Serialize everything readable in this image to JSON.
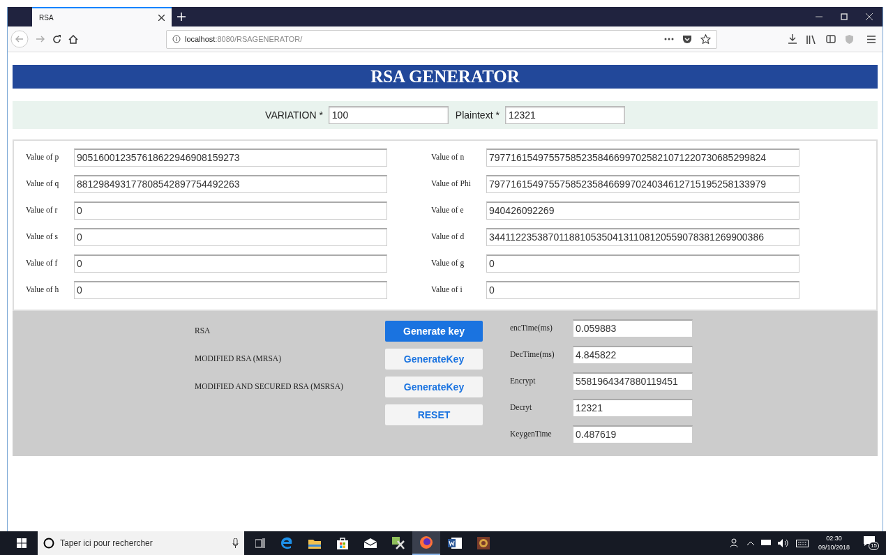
{
  "browser": {
    "tabs": [
      {
        "title": "RSA",
        "selected": true
      }
    ],
    "url_host": "localhost",
    "url_path": ":8080/RSAGENERATOR/"
  },
  "page": {
    "title": "RSA GENERATOR",
    "inputs": [
      {
        "label": "VARIATION *",
        "value": "100"
      },
      {
        "label": "Plaintext *",
        "value": "12321"
      }
    ],
    "fields_left": [
      {
        "label": "Value of p",
        "value": "905160012357618622946908159273"
      },
      {
        "label": "Value of q",
        "value": "881298493177808542897754492263"
      },
      {
        "label": "Value of r",
        "value": "0"
      },
      {
        "label": "Value of s",
        "value": "0"
      },
      {
        "label": "Value of f",
        "value": "0"
      },
      {
        "label": "Value of h",
        "value": "0"
      }
    ],
    "fields_right": [
      {
        "label": "Value of n",
        "value": "797716154975575852358466997025821071220730685299824"
      },
      {
        "label": "Value of Phi",
        "value": "797716154975575852358466997024034612715195258133979"
      },
      {
        "label": "Value of e",
        "value": "940426092269"
      },
      {
        "label": "Value of d",
        "value": "344112235387011881053504131108120559078381269900386"
      },
      {
        "label": "Value of g",
        "value": "0"
      },
      {
        "label": "Value of i",
        "value": "0"
      }
    ],
    "algorithms": [
      {
        "label": "RSA",
        "button": "Generate key",
        "active": true
      },
      {
        "label": "MODIFIED RSA (MRSA)",
        "button": "GenerateKey",
        "active": false
      },
      {
        "label": "MODIFIED AND SECURED RSA (MSRSA)",
        "button": "GenerateKey",
        "active": false
      }
    ],
    "reset_button": "RESET",
    "results": [
      {
        "label": "encTime(ms)",
        "value": "0.059883"
      },
      {
        "label": "DecTime(ms)",
        "value": "4.845822"
      },
      {
        "label": "Encrypt",
        "value": "5581964347880119451"
      },
      {
        "label": "Decryt",
        "value": "12321"
      },
      {
        "label": "KeygenTime",
        "value": "0.487619"
      }
    ]
  },
  "taskbar": {
    "search_placeholder": "Taper ici pour rechercher",
    "time": "02:30",
    "date": "09/10/2018",
    "notifications": "15"
  }
}
